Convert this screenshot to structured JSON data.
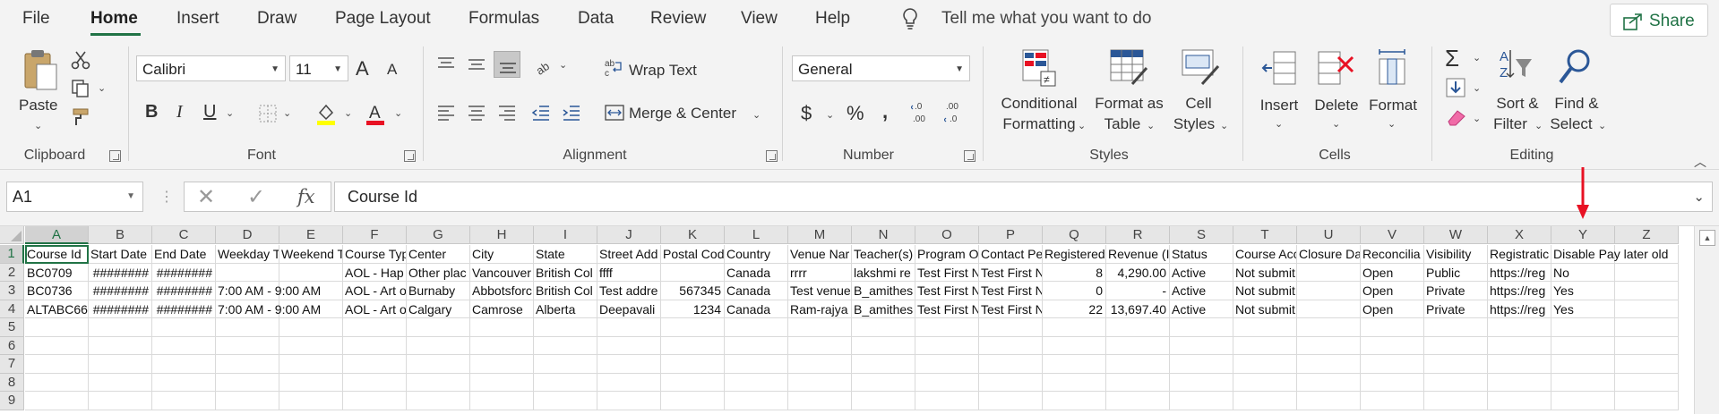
{
  "menu": {
    "items": [
      "File",
      "Home",
      "Insert",
      "Draw",
      "Page Layout",
      "Formulas",
      "Data",
      "Review",
      "View",
      "Help"
    ],
    "active": "Home",
    "tell_me": "Tell me what you want to do",
    "share": "Share"
  },
  "ribbon": {
    "clipboard": {
      "paste": "Paste",
      "label": "Clipboard"
    },
    "font": {
      "name": "Calibri",
      "size": "11",
      "bold": "B",
      "italic": "I",
      "underline": "U",
      "grow": "A",
      "shrink": "A",
      "label": "Font"
    },
    "alignment": {
      "wrap_text": "Wrap Text",
      "merge_center": "Merge & Center",
      "label": "Alignment"
    },
    "number": {
      "format": "General",
      "currency": "$",
      "percent": "%",
      "comma": "௹",
      "inc_decimal": ".00\n←.0",
      "label": "Number"
    },
    "styles": {
      "conditional": [
        "Conditional",
        "Formatting"
      ],
      "format_as_table": [
        "Format as",
        "Table"
      ],
      "cell_styles": [
        "Cell",
        "Styles"
      ],
      "label": "Styles"
    },
    "cells": {
      "insert": "Insert",
      "delete": "Delete",
      "format": "Format",
      "label": "Cells"
    },
    "editing": {
      "autosum": "Σ",
      "sort_filter": [
        "Sort &",
        "Filter"
      ],
      "find_select": [
        "Find &",
        "Select"
      ],
      "label": "Editing"
    }
  },
  "formula_bar": {
    "name_box": "A1",
    "cancel": "✕",
    "enter": "✓",
    "fx": "fx",
    "content": "Course Id"
  },
  "sheet": {
    "columns": [
      "A",
      "B",
      "C",
      "D",
      "E",
      "F",
      "G",
      "H",
      "I",
      "J",
      "K",
      "L",
      "M",
      "N",
      "O",
      "P",
      "Q",
      "R",
      "S",
      "T",
      "U",
      "V",
      "W",
      "X",
      "Y",
      "Z"
    ],
    "row_numbers": [
      "1",
      "2",
      "3",
      "4",
      "5",
      "6",
      "7",
      "8",
      "9"
    ],
    "rows": [
      [
        "Course Id",
        "Start Date",
        "End Date",
        "Weekday T",
        "Weekend T",
        "Course Typ",
        "Center",
        "City",
        "State",
        "Street Add",
        "Postal Cod",
        "Country",
        "Venue Nar",
        "Teacher(s)",
        "Program O",
        "Contact Pe",
        "Registered",
        "Revenue (I",
        "Status",
        "Course Acc",
        "Closure Da",
        "Reconcilia",
        "Visibility",
        "Registratic",
        "Disable Pay later old",
        ""
      ],
      [
        "BC0709",
        "########",
        "########",
        "",
        "",
        "AOL - Hap",
        "Other plac",
        "Vancouver",
        "British Col",
        "ffff",
        "",
        "Canada",
        "rrrr",
        "lakshmi  re",
        "Test First N",
        "Test First N",
        "8",
        "4,290.00",
        "Active",
        "Not submit",
        "",
        "Open",
        "Public",
        "https://reg",
        "No",
        ""
      ],
      [
        "BC0736",
        "########",
        "########",
        "7:00 AM - 9:00 AM",
        "",
        "AOL - Art o",
        "Burnaby",
        "Abbotsforc",
        "British Col",
        "Test addre",
        "567345",
        "Canada",
        "Test venue",
        "B_amithes",
        "Test First N",
        "Test First N",
        "0",
        "-",
        "Active",
        "Not submit",
        "",
        "Open",
        "Private",
        "https://reg",
        "Yes",
        ""
      ],
      [
        "ALTABC66",
        "########",
        "########",
        "7:00 AM - 9:00 AM",
        "",
        "AOL - Art o",
        "Calgary",
        "Camrose",
        "Alberta",
        "Deepavali",
        "1234",
        "Canada",
        "Ram-rajya",
        "B_amithes",
        "Test First N",
        "Test First N",
        "22",
        "13,697.40",
        "Active",
        "Not submit",
        "",
        "Open",
        "Private",
        "https://reg",
        "Yes",
        ""
      ]
    ]
  },
  "colors": {
    "accent": "#217346",
    "annotation_arrow": "#e81123"
  }
}
